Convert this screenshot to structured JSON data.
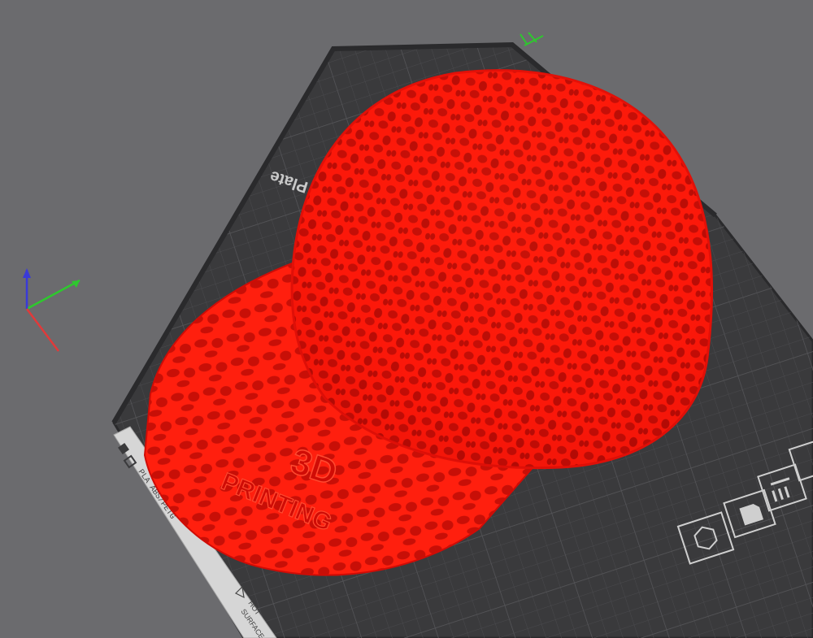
{
  "viewport": {
    "background_color": "#6b6b6e",
    "bed": {
      "label": "Plate",
      "surface_color": "#3a3a3c",
      "frame_color": "#2c2c2e",
      "grid_color": "#4a4a4d"
    },
    "plate_tag": {
      "material_text": "PLA ABS/PETG",
      "hot_surface_line1": "HOT",
      "hot_surface_line2": "SURFACE"
    },
    "model": {
      "name": "voronoi-cap",
      "color": "#ff1a0a",
      "embossed_text_line1": "3D",
      "embossed_text_line2": "PRINTING"
    },
    "axes": {
      "x_color": "#e03a3a",
      "y_color": "#2ec82e",
      "z_color": "#3a3ad8",
      "corner_mark_color": "#2ec82e"
    },
    "icons": [
      "nut-icon",
      "sd-card-icon",
      "slice-preview-icon",
      "printer-icon"
    ]
  }
}
